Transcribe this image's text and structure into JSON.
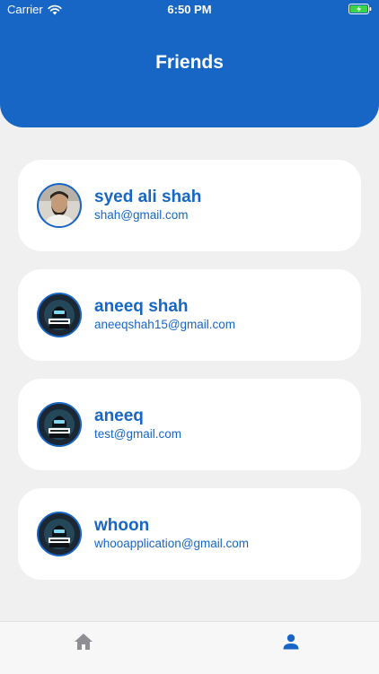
{
  "status_bar": {
    "carrier": "Carrier",
    "time": "6:50 PM",
    "wifi_icon": "wifi-icon",
    "battery_icon": "battery-charging-icon"
  },
  "header": {
    "title": "Friends",
    "color": "#1766c5"
  },
  "friends": [
    {
      "name": "syed ali shah",
      "email": "shah@gmail.com",
      "avatar": "person-photo"
    },
    {
      "name": "aneeq shah",
      "email": "aneeqshah15@gmail.com",
      "avatar": "gamer-logo"
    },
    {
      "name": "aneeq",
      "email": "test@gmail.com",
      "avatar": "gamer-logo"
    },
    {
      "name": "whoon",
      "email": "whooapplication@gmail.com",
      "avatar": "gamer-logo"
    }
  ],
  "bottom_nav": {
    "items": [
      {
        "icon": "home-icon",
        "active": false,
        "color": "#8e8e93"
      },
      {
        "icon": "person-icon",
        "active": true,
        "color": "#1766c5"
      }
    ]
  },
  "colors": {
    "accent": "#1766c5",
    "background": "#f0f0f0",
    "card": "#ffffff"
  }
}
